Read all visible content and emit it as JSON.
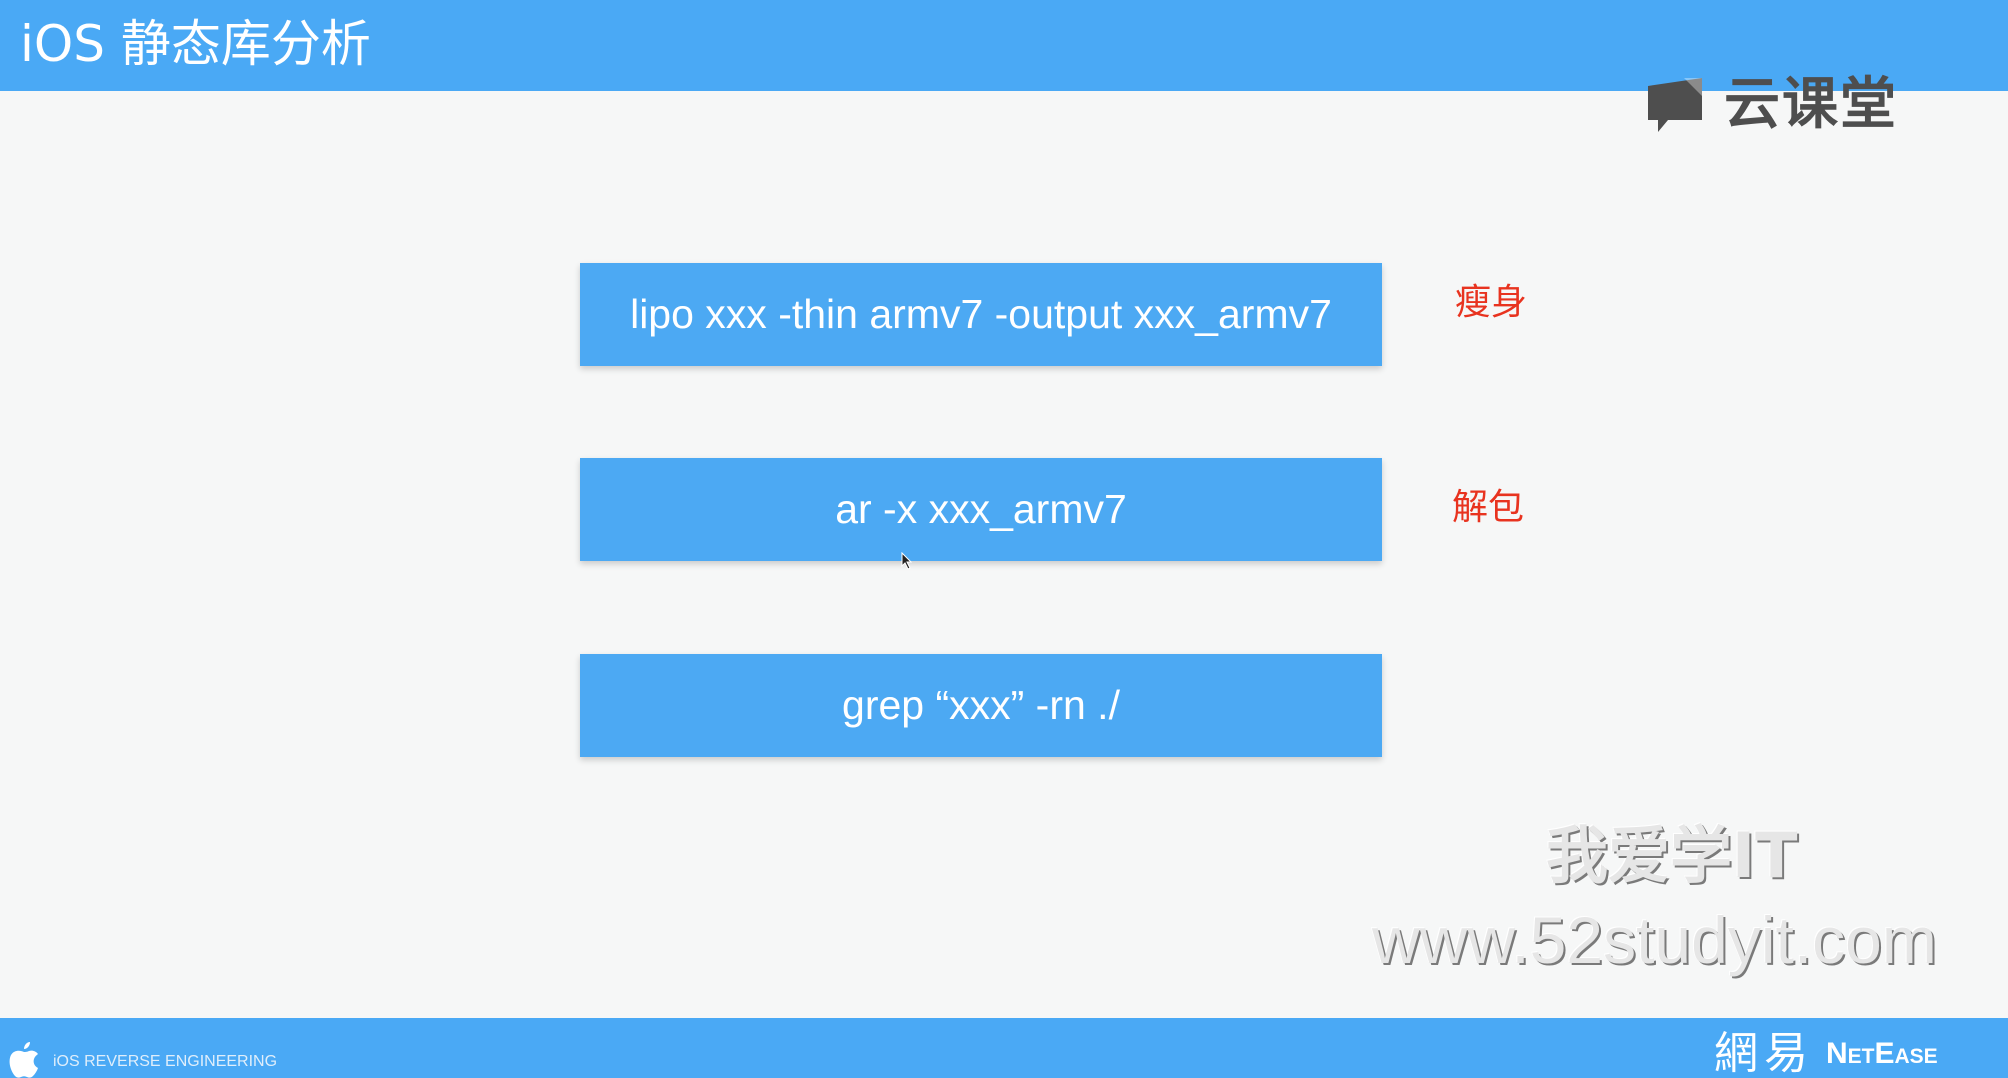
{
  "header": {
    "title": "iOS 静态库分析"
  },
  "brand": {
    "icon": "cloud-classroom-icon",
    "name": "云课堂"
  },
  "commands": [
    {
      "text": "lipo xxx -thin armv7 -output xxx_armv7",
      "note": "瘦身"
    },
    {
      "text": "ar -x xxx_armv7",
      "note": "解包"
    },
    {
      "text": "grep “xxx” -rn ./",
      "note": ""
    }
  ],
  "watermark": {
    "line1": "我爱学IT",
    "line2": "www.52studyit.com"
  },
  "footer": {
    "icon": "apple-logo-icon",
    "label": "iOS REVERSE ENGINEERING",
    "company_cn": "網易",
    "company_en": "NetEase"
  },
  "colors": {
    "bar_blue": "#4aa9f5",
    "box_blue": "#4ca9f3",
    "note_red": "#e8331f",
    "background": "#f6f7f7"
  }
}
